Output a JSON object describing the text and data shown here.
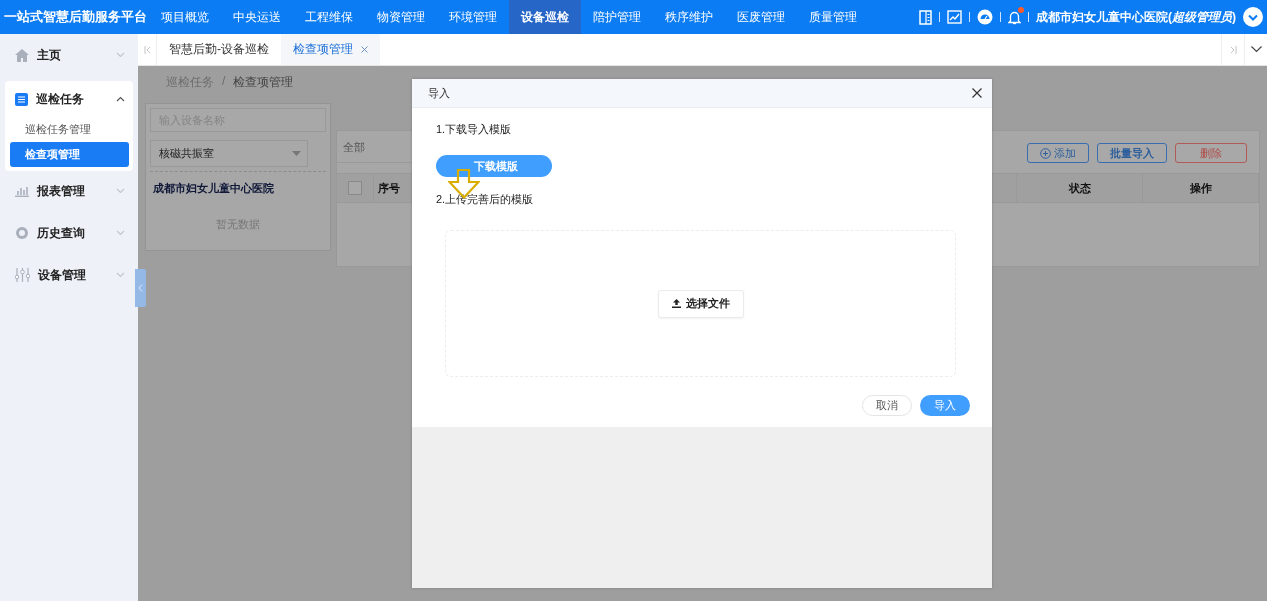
{
  "app": {
    "title": "一站式智慧后勤服务平台"
  },
  "top_nav": [
    {
      "label": "项目概览",
      "selected": false
    },
    {
      "label": "中央运送",
      "selected": false
    },
    {
      "label": "工程维保",
      "selected": false
    },
    {
      "label": "物资管理",
      "selected": false
    },
    {
      "label": "环境管理",
      "selected": false
    },
    {
      "label": "设备巡检",
      "selected": true
    },
    {
      "label": "陪护管理",
      "selected": false
    },
    {
      "label": "秩序维护",
      "selected": false
    },
    {
      "label": "医废管理",
      "selected": false
    },
    {
      "label": "质量管理",
      "selected": false
    }
  ],
  "header": {
    "unread_notifications": true,
    "user": "成都市妇女儿童中心医院(*超级管理员*)"
  },
  "sidebar": {
    "items": [
      {
        "label": "主页",
        "expanded": false
      },
      {
        "label": "巡检任务",
        "expanded": true,
        "children": [
          {
            "label": "巡检任务管理",
            "selected": false
          },
          {
            "label": "检查项管理",
            "selected": true
          }
        ]
      },
      {
        "label": "报表管理",
        "expanded": false
      },
      {
        "label": "历史查询",
        "expanded": false
      },
      {
        "label": "设备管理",
        "expanded": false
      }
    ]
  },
  "tabs": [
    {
      "label": "智慧后勤-设备巡检",
      "selected": false,
      "closable": false
    },
    {
      "label": "检查项管理",
      "selected": true,
      "closable": true
    }
  ],
  "breadcrumb": {
    "items": [
      "巡检任务",
      "检查项管理"
    ],
    "separator": "/"
  },
  "left_panel": {
    "search": {
      "placeholder": "输入设备名称"
    },
    "select": {
      "value": "核磁共振室"
    },
    "tree_root": "成都市妇女儿童中心医院",
    "empty_text": "暂无数据"
  },
  "right_panel": {
    "filter": {
      "placeholder": "全部"
    },
    "buttons": [
      {
        "label": "添加",
        "kind": "add"
      },
      {
        "label": "批量导入",
        "kind": "outline"
      },
      {
        "label": "删除",
        "kind": "danger"
      }
    ],
    "table": {
      "columns": [
        {
          "kind": "checkbox",
          "checked": false
        },
        {
          "kind": "text",
          "label": "序号"
        },
        {
          "kind": "gap"
        },
        {
          "kind": "text",
          "label": "状态"
        },
        {
          "kind": "text",
          "label": "操作"
        }
      ]
    }
  },
  "dialog": {
    "title": "导入",
    "step_1": "1.下载导入模版",
    "download_button": "下载模版",
    "step_2": "2.上传完善后的模版",
    "choose_file_button": "选择文件",
    "buttons": [
      {
        "label": "取消",
        "kind": "default"
      },
      {
        "label": "导入",
        "kind": "primary"
      }
    ]
  }
}
